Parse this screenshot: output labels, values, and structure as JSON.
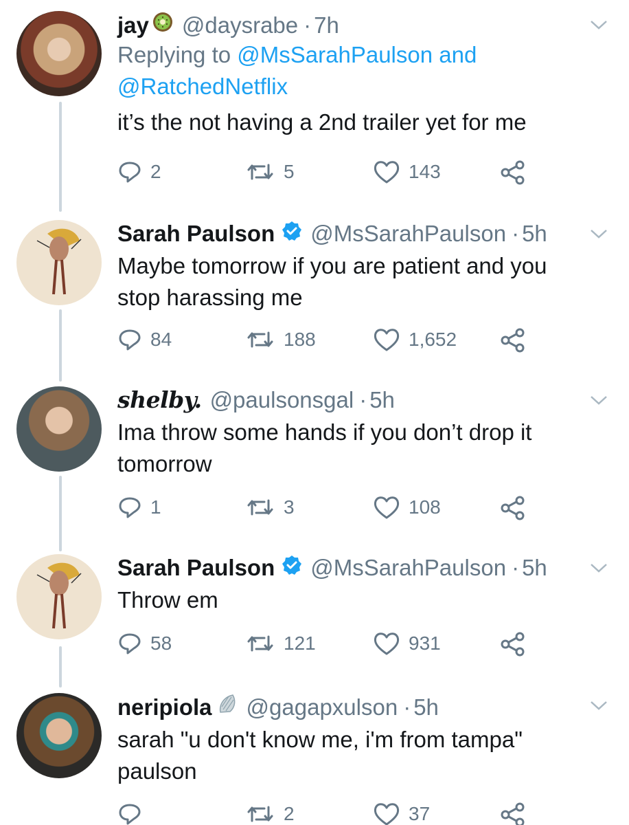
{
  "colors": {
    "link": "#1da1f2",
    "muted": "#657786",
    "text": "#14171a",
    "thread": "#ccd6dd"
  },
  "tweets": [
    {
      "name": "jay",
      "name_emoji": "kiwi-emoji",
      "handle": "@daysrabe",
      "dot": "·",
      "time": "7h",
      "reply_prefix": "Replying to",
      "reply_user1": "@MsSarahPaulson",
      "reply_and": "and",
      "reply_user2": "@RatchedNetflix",
      "text": "it’s the not having a 2nd trailer yet for me",
      "replies": "2",
      "retweets": "5",
      "likes": "143"
    },
    {
      "name": "Sarah Paulson",
      "verified": true,
      "handle": "@MsSarahPaulson",
      "dot": "·",
      "time": "5h",
      "text_line1": "Maybe tomorrow if you are patient and you",
      "text_line2": "stop harassing me",
      "replies": "84",
      "retweets": "188",
      "likes": "1,652"
    },
    {
      "name": "shelby.",
      "handle": "@paulsonsgal",
      "dot": "·",
      "time": "5h",
      "text_line1": "Ima throw some hands if you don’t drop it",
      "text_line2": "tomorrow",
      "replies": "1",
      "retweets": "3",
      "likes": "108"
    },
    {
      "name": "Sarah Paulson",
      "verified": true,
      "handle": "@MsSarahPaulson",
      "dot": "·",
      "time": "5h",
      "text": "Throw em",
      "replies": "58",
      "retweets": "121",
      "likes": "931"
    },
    {
      "name": "neripiola",
      "name_emoji": "shell-emoji",
      "handle": "@gagapxulson",
      "dot": "·",
      "time": "5h",
      "text_line1": "sarah \"u don't know me, i'm from tampa\"",
      "text_line2": "paulson",
      "replies": "",
      "retweets": "2",
      "likes": "37"
    }
  ]
}
